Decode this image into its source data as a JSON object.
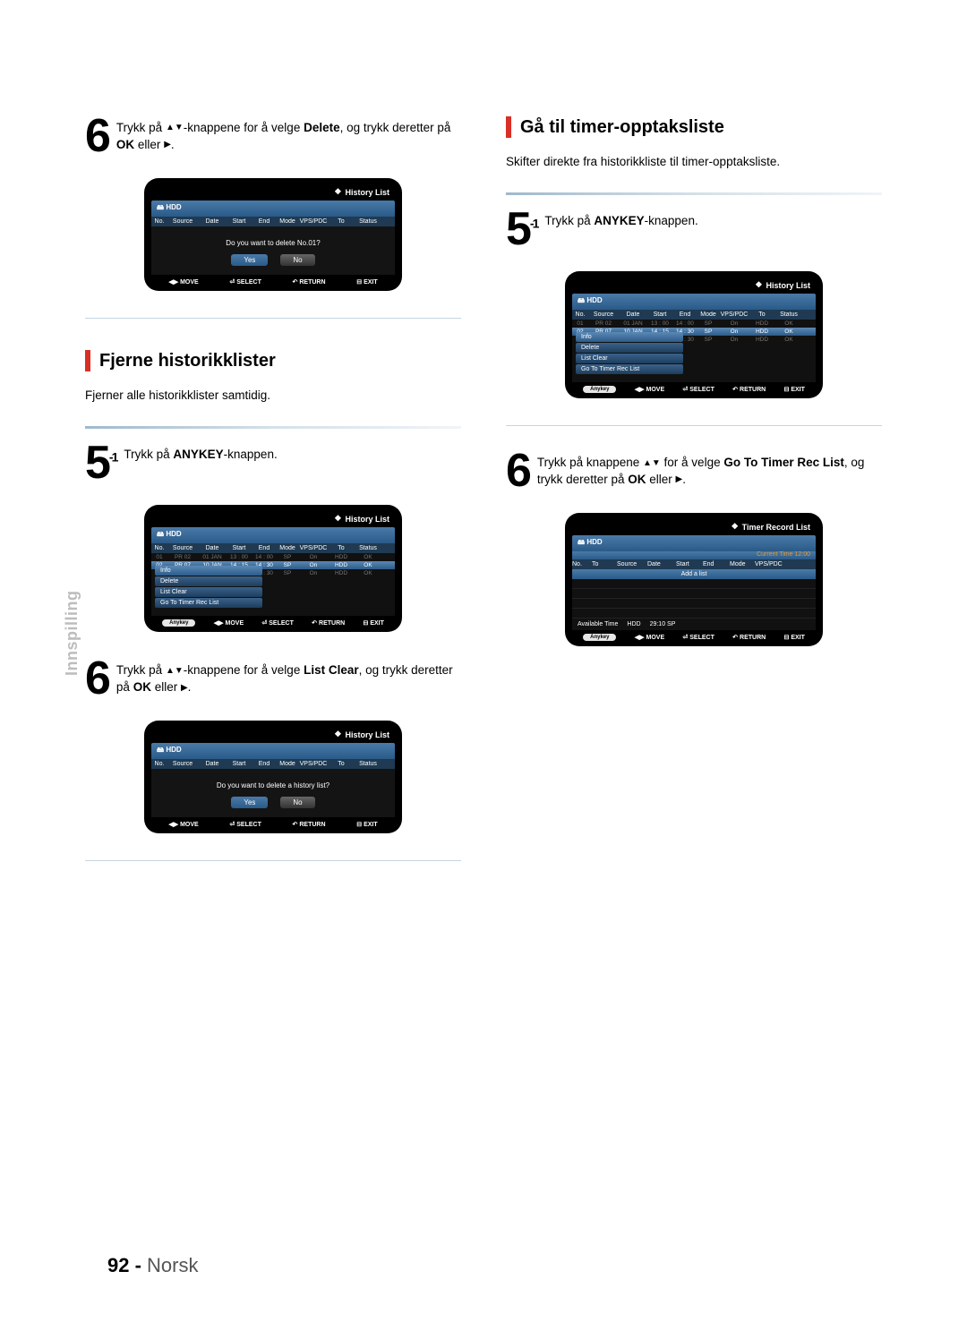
{
  "side_label": "Innspilling",
  "page_number": "92 -",
  "page_lang": "Norsk",
  "left": {
    "step6_top": {
      "num": "6",
      "text_a": "Trykk på ",
      "text_b": "-knappene for å velge ",
      "bold1": "Delete",
      "text_c": ", og trykk deretter på ",
      "bold2": "OK",
      "text_d": " eller ",
      "text_e": "."
    },
    "osd1": {
      "title": "History List",
      "storage": "HDD",
      "headers": [
        "No.",
        "Source",
        "Date",
        "Start",
        "End",
        "Mode",
        "VPS/PDC",
        "To",
        "Status"
      ],
      "confirm": "Do you want to delete No.01?",
      "yes": "Yes",
      "no": "No",
      "foot": {
        "move": "MOVE",
        "select": "SELECT",
        "return": "RETURN",
        "exit": "EXIT"
      }
    },
    "section1_title": "Fjerne historikklister",
    "section1_body": "Fjerner alle historikklister samtidig.",
    "step5_1": {
      "num": "5",
      "sup": "-1",
      "text_a": " Trykk på ",
      "bold1": "ANYKEY",
      "text_b": "-knappen."
    },
    "osd2": {
      "title": "History List",
      "storage": "HDD",
      "headers": [
        "No.",
        "Source",
        "Date",
        "Start",
        "End",
        "Mode",
        "VPS/PDC",
        "To",
        "Status"
      ],
      "rows": [
        {
          "no": "01",
          "source": "PR 02",
          "date": "01 JAN",
          "start": "13 : 00",
          "end": "14 : 00",
          "mode": "SP",
          "vps": "On",
          "to": "HDD",
          "status": "OK"
        },
        {
          "no": "02",
          "source": "PR 07",
          "date": "10 JAN",
          "start": "14 : 15",
          "end": "14 : 30",
          "mode": "SP",
          "vps": "On",
          "to": "HDD",
          "status": "OK"
        },
        {
          "no": "",
          "source": "",
          "date": "",
          "start": "",
          "end": "18 : 30",
          "mode": "SP",
          "vps": "On",
          "to": "HDD",
          "status": "OK"
        }
      ],
      "menu": [
        "Info",
        "Delete",
        "List Clear",
        "Go To Timer Rec List"
      ],
      "anykey": "Anykey",
      "foot": {
        "move": "MOVE",
        "select": "SELECT",
        "return": "RETURN",
        "exit": "EXIT"
      }
    },
    "step6_mid": {
      "num": "6",
      "text_a": "Trykk på ",
      "text_b": "-knappene for å velge ",
      "bold1": "List Clear",
      "text_c": ", og trykk deretter på ",
      "bold2": "OK",
      "text_d": " eller ",
      "text_e": "."
    },
    "osd3": {
      "title": "History List",
      "storage": "HDD",
      "headers": [
        "No.",
        "Source",
        "Date",
        "Start",
        "End",
        "Mode",
        "VPS/PDC",
        "To",
        "Status"
      ],
      "confirm": "Do you want to delete a history list?",
      "yes": "Yes",
      "no": "No",
      "foot": {
        "move": "MOVE",
        "select": "SELECT",
        "return": "RETURN",
        "exit": "EXIT"
      }
    }
  },
  "right": {
    "section1_title": "Gå til timer-opptaksliste",
    "section1_body": "Skifter direkte fra historikkliste til timer-opptaksliste.",
    "step5_1": {
      "num": "5",
      "sup": "-1",
      "text_a": " Trykk på ",
      "bold1": "ANYKEY",
      "text_b": "-knappen."
    },
    "osd1": {
      "title": "History List",
      "storage": "HDD",
      "headers": [
        "No.",
        "Source",
        "Date",
        "Start",
        "End",
        "Mode",
        "VPS/PDC",
        "To",
        "Status"
      ],
      "rows": [
        {
          "no": "01",
          "source": "PR 02",
          "date": "01 JAN",
          "start": "13 : 00",
          "end": "14 : 00",
          "mode": "SP",
          "vps": "On",
          "to": "HDD",
          "status": "OK"
        },
        {
          "no": "02",
          "source": "PR 07",
          "date": "10 JAN",
          "start": "14 : 15",
          "end": "14 : 30",
          "mode": "SP",
          "vps": "On",
          "to": "HDD",
          "status": "OK"
        },
        {
          "no": "",
          "source": "",
          "date": "",
          "start": "",
          "end": "18 : 30",
          "mode": "SP",
          "vps": "On",
          "to": "HDD",
          "status": "OK"
        }
      ],
      "menu": [
        "Info",
        "Delete",
        "List Clear",
        "Go To Timer Rec List"
      ],
      "anykey": "Anykey",
      "foot": {
        "move": "MOVE",
        "select": "SELECT",
        "return": "RETURN",
        "exit": "EXIT"
      }
    },
    "step6": {
      "num": "6",
      "text_a": "Trykk på knappene ",
      "text_b": " for å velge ",
      "bold1": "Go To Timer Rec List",
      "text_c": ", og trykk deretter på ",
      "bold2": "OK",
      "text_d": " eller ",
      "text_e": "."
    },
    "osd2": {
      "title": "Timer Record List",
      "storage": "HDD",
      "curtime": "Current Time 12:00",
      "headers": [
        "No.",
        "To",
        "Source",
        "Date",
        "Start",
        "End",
        "Mode",
        "VPS/PDC"
      ],
      "add": "Add a list",
      "avail_label": "Available Time",
      "avail_to": "HDD",
      "avail_val": "29:10  SP",
      "anykey": "Anykey",
      "foot": {
        "move": "MOVE",
        "select": "SELECT",
        "return": "RETURN",
        "exit": "EXIT"
      }
    }
  }
}
